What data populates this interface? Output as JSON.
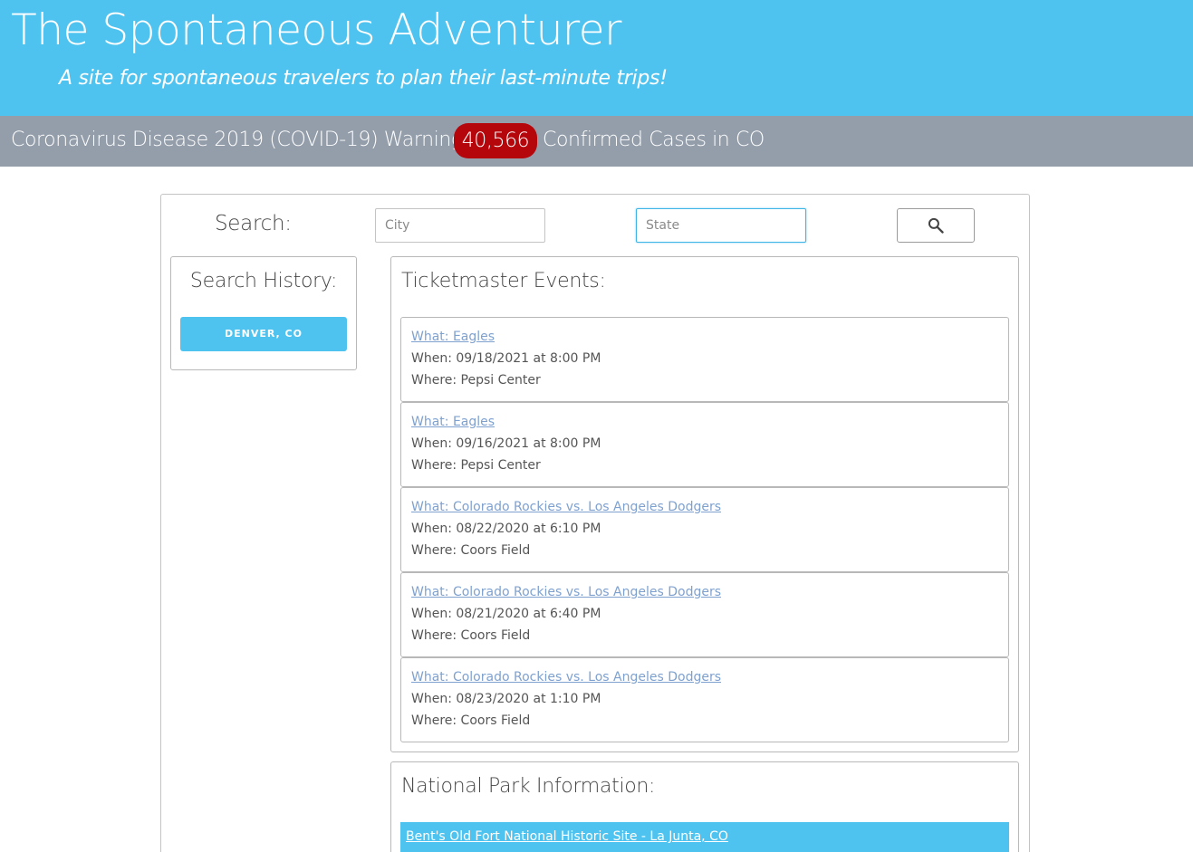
{
  "header": {
    "title": "The Spontaneous Adventurer",
    "subtitle": "A site for spontaneous travelers to plan their last-minute trips!"
  },
  "warning": {
    "prefix": "Coronavirus Disease 2019 (COVID-19) Warning:",
    "count": "40,566",
    "suffix": "Confirmed Cases in CO"
  },
  "search": {
    "label": "Search:",
    "city_placeholder": "City",
    "state_placeholder": "State",
    "button_icon": "search-icon"
  },
  "history": {
    "title": "Search History:",
    "items": [
      "DENVER, CO"
    ]
  },
  "events": {
    "title": "Ticketmaster Events:",
    "items": [
      {
        "what": "What: Eagles",
        "when": "When: 09/18/2021 at 8:00 PM",
        "where": "Where: Pepsi Center"
      },
      {
        "what": "What: Eagles",
        "when": "When: 09/16/2021 at 8:00 PM",
        "where": "Where: Pepsi Center"
      },
      {
        "what": "What: Colorado Rockies vs. Los Angeles Dodgers",
        "when": "When: 08/22/2020 at 6:10 PM",
        "where": "Where: Coors Field"
      },
      {
        "what": "What: Colorado Rockies vs. Los Angeles Dodgers",
        "when": "When: 08/21/2020 at 6:40 PM",
        "where": "Where: Coors Field"
      },
      {
        "what": "What: Colorado Rockies vs. Los Angeles Dodgers",
        "when": "When: 08/23/2020 at 1:10 PM",
        "where": "Where: Coors Field"
      }
    ]
  },
  "parks": {
    "title": "National Park Information:",
    "items": [
      "Bent's Old Fort National Historic Site - La Junta, CO"
    ]
  },
  "colors": {
    "header_bg": "#4fc3f0",
    "warning_bg": "#949eab",
    "badge_bg": "#b5060c",
    "link": "#7fa1cf"
  }
}
